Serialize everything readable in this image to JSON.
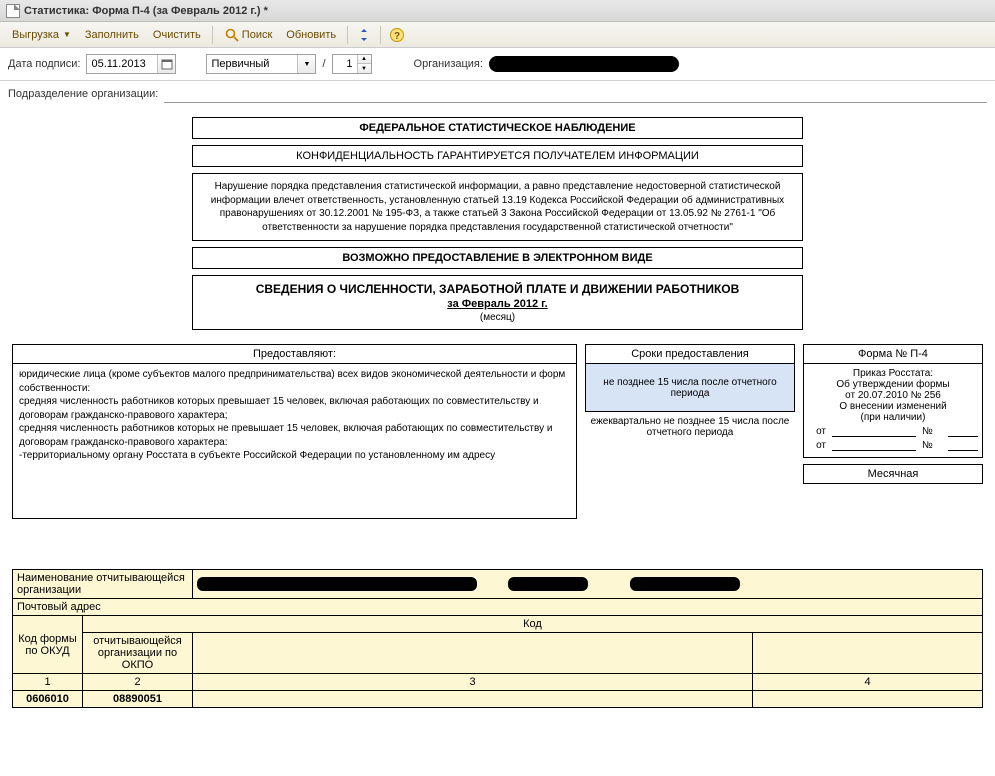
{
  "window": {
    "title": "Статистика: Форма П-4 (за Февраль 2012 г.) *"
  },
  "toolbar": {
    "unload": "Выгрузка",
    "fill": "Заполнить",
    "clear": "Очистить",
    "search": "Поиск",
    "refresh": "Обновить"
  },
  "form": {
    "date_label": "Дата подписи:",
    "date_value": "05.11.2013",
    "type_value": "Первичный",
    "slash": "/",
    "num_value": "1",
    "org_label": "Организация:",
    "subdiv_label": "Подразделение организации:"
  },
  "boxes": {
    "b1": "ФЕДЕРАЛЬНОЕ СТАТИСТИЧЕСКОЕ НАБЛЮДЕНИЕ",
    "b2": "КОНФИДЕНЦИАЛЬНОСТЬ ГАРАНТИРУЕТСЯ ПОЛУЧАТЕЛЕМ ИНФОРМАЦИИ",
    "b3": "Нарушение порядка представления статистической информации, а равно представление недостоверной статистической информации влечет ответственность, установленную статьей 13.19 Кодекса Российской Федерации об административных правонарушениях от 30.12.2001 № 195-ФЗ, а также статьей 3 Закона Российской Федерации от 13.05.92 № 2761-1 \"Об ответственности за нарушение порядка представления государственной статистической отчетности\"",
    "b4": "ВОЗМОЖНО ПРЕДОСТАВЛЕНИЕ В ЭЛЕКТРОННОМ ВИДЕ",
    "t1": "СВЕДЕНИЯ О ЧИСЛЕННОСТИ, ЗАРАБОТНОЙ ПЛАТЕ И ДВИЖЕНИИ РАБОТНИКОВ",
    "t2": "за Февраль 2012 г.",
    "t3": "(месяц)"
  },
  "cols": {
    "left_h": "Предоставляют:",
    "left_b": "юридические лица (кроме субъектов малого предпринимательства) всех видов экономической деятельности и форм собственности:\n  средняя численность работников которых превышает 15 человек, включая работающих по совместительству и договорам гражданско-правового характера;\n  средняя численность работников которых не превышает 15 человек, включая работающих по совместительству и договорам гражданско-правового характера:\n   -территориальному органу Росстата в субъекте Российской Федерации по установленному им адресу",
    "mid_h": "Сроки предоставления",
    "mid_1": "не позднее 15 числа после отчетного периода",
    "mid_2": "ежеквартально не позднее 15 числа после отчетного периода",
    "right_h": "Форма № П-4",
    "right_1": "Приказ Росстата:",
    "right_2": "Об утверждении формы",
    "right_3": "от 20.07.2010 № 256",
    "right_4": "О внесении изменений",
    "right_5": "(при наличии)",
    "ot": "от",
    "no": "№",
    "monthly": "Месячная"
  },
  "btable": {
    "r1": "Наименование отчитывающейся организации",
    "r2": "Почтовый адрес",
    "r3": "Код",
    "c1": "Код формы по ОКУД",
    "c2": "отчитывающейся организации по ОКПО",
    "n1": "1",
    "n2": "2",
    "n3": "3",
    "n4": "4",
    "v1": "0606010",
    "v2": "08890051"
  }
}
